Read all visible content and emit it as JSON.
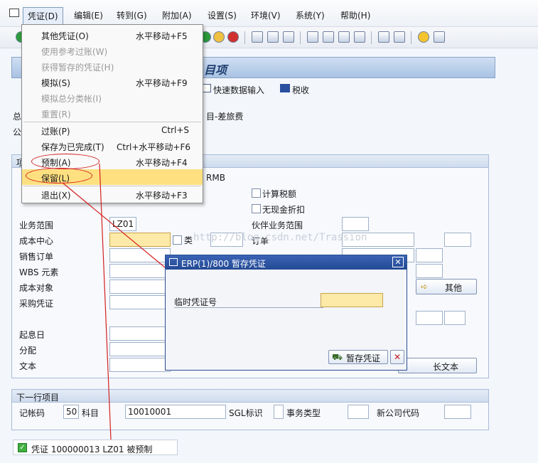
{
  "menubar": {
    "items": [
      "凭证(D)",
      "编辑(E)",
      "转到(G)",
      "附加(A)",
      "设置(S)",
      "环境(V)",
      "系统(Y)",
      "帮助(H)"
    ]
  },
  "screen": {
    "title": "目项",
    "toolbar": {
      "fast_entry": "快速数据输入",
      "tax": "税收"
    },
    "header_rows": {
      "row1_prefix": "总",
      "row1_text": "目-差旅费",
      "row2_prefix": "公"
    },
    "item_group": {
      "header": "项",
      "currency": "RMB",
      "calc_tax": "计算税额",
      "no_cash_discount": "无现金折扣",
      "labels": [
        "业务范围",
        "成本中心",
        "销售订单",
        "WBS 元素",
        "成本对象",
        "采购凭证",
        "起息日",
        "分配",
        "文本"
      ],
      "business_area_value": "LZ01",
      "class_label": "类",
      "partner_ba": "伙伴业务范围",
      "order": "订单",
      "other_button": "其他",
      "longtext_button": "长文本",
      "watermark": "http://blog.csdn.net/Trassion"
    },
    "next_item": {
      "header": "下一行项目",
      "posting_key_label": "记帐码",
      "posting_key": "50",
      "account_label": "科目",
      "account": "10010001",
      "sgl_label": "SGL标识",
      "trans_type_label": "事务类型",
      "new_company_label": "新公司代码"
    }
  },
  "dropdown": {
    "items": [
      {
        "label": "其他凭证(O)",
        "shortcut": "水平移动+F5",
        "disabled": false
      },
      {
        "label": "使用参考过账(W)",
        "shortcut": "",
        "disabled": true
      },
      {
        "label": "获得暂存的凭证(H)",
        "shortcut": "",
        "disabled": true
      },
      {
        "label": "模拟(S)",
        "shortcut": "水平移动+F9",
        "disabled": false
      },
      {
        "label": "模拟总分类帐(I)",
        "shortcut": "",
        "disabled": true
      },
      {
        "label": "重置(R)",
        "shortcut": "",
        "disabled": true
      },
      {
        "label": "过账(P)",
        "shortcut": "Ctrl+S",
        "disabled": false
      },
      {
        "label": "保存为已完成(T)",
        "shortcut": "Ctrl+水平移动+F6",
        "disabled": false
      },
      {
        "label": "预制(A)",
        "shortcut": "水平移动+F4",
        "disabled": false
      },
      {
        "label": "保留(L)",
        "shortcut": "",
        "disabled": false
      },
      {
        "label": "退出(X)",
        "shortcut": "水平移动+F3",
        "disabled": false
      }
    ]
  },
  "dialog": {
    "title": "ERP(1)/800 暂存凭证",
    "field_label": "临时凭证号",
    "field_value": "",
    "save_button": "暂存凭证"
  },
  "status": {
    "message": "凭证 100000013 LZ01 被预制"
  },
  "colors": {
    "highlight": "#ffe080",
    "required_field": "#fdeaa8",
    "annotation": "#d42020"
  }
}
